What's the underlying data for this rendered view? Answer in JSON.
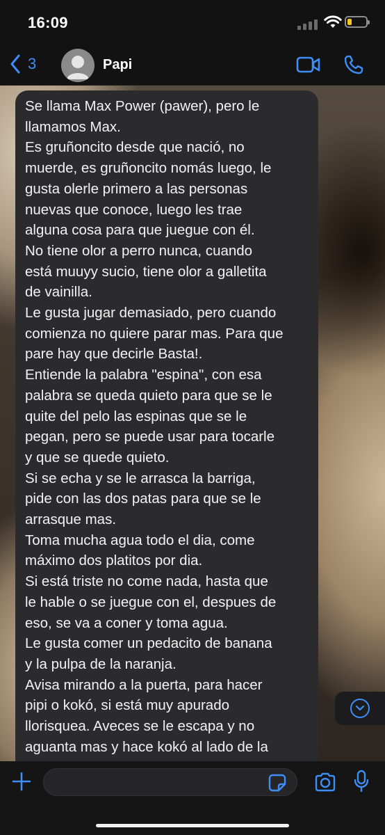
{
  "status_bar": {
    "time": "16:09",
    "battery_level": 0.22,
    "battery_color": "#f4c81b"
  },
  "header": {
    "back_count": "3",
    "contact_name": "Papi",
    "back_icon": "chevron-left-icon",
    "video_icon": "video-camera-icon",
    "call_icon": "phone-icon",
    "accent_color": "#3e8ef7"
  },
  "message": {
    "text": "Se llama Max Power (pawer), pero le\nllamamos Max.\nEs gruñoncito desde que nació, no\nmuerde, es gruñoncito nomás luego, le\ngusta olerle primero a las personas\nnuevas que conoce, luego les trae\nalguna cosa para que juegue con él.\nNo tiene olor a perro nunca, cuando\nestá muuyy sucio, tiene olor a galletita\nde vainilla.\nLe gusta jugar demasiado, pero cuando\ncomienza no quiere parar mas. Para que\npare hay que decirle Basta!.\nEntiende la palabra \"espina\", con esa\npalabra se queda quieto para que se le\nquite del pelo las espinas que se le\npegan, pero se puede usar para tocarle\ny que se quede quieto.\nSi se echa y se le arrasca la barriga,\npide con las dos patas para que se le\narrasque mas.\nToma mucha agua todo el dia, come\nmáximo dos platitos por dia.\nSi está triste no come nada, hasta que\nle hable o se juegue con el, despues de\neso, se va a coner y toma agua.\nLe gusta comer un pedacito de banana\ny la pulpa de la naranja.\nAvisa mirando a la puerta, para hacer\npipi o kokó, si está muy apurado\nllorisquea. Aveces se le escapa y no\naguanta mas y hace kokó al lado de la\npuerta, por si no nos dimos cuenta que"
  },
  "composer": {
    "input_value": "",
    "plus_icon": "plus-icon",
    "sticker_icon": "sticker-icon",
    "camera_icon": "camera-icon",
    "mic_icon": "microphone-icon"
  },
  "scroll_button": {
    "icon": "chevron-down-icon"
  }
}
